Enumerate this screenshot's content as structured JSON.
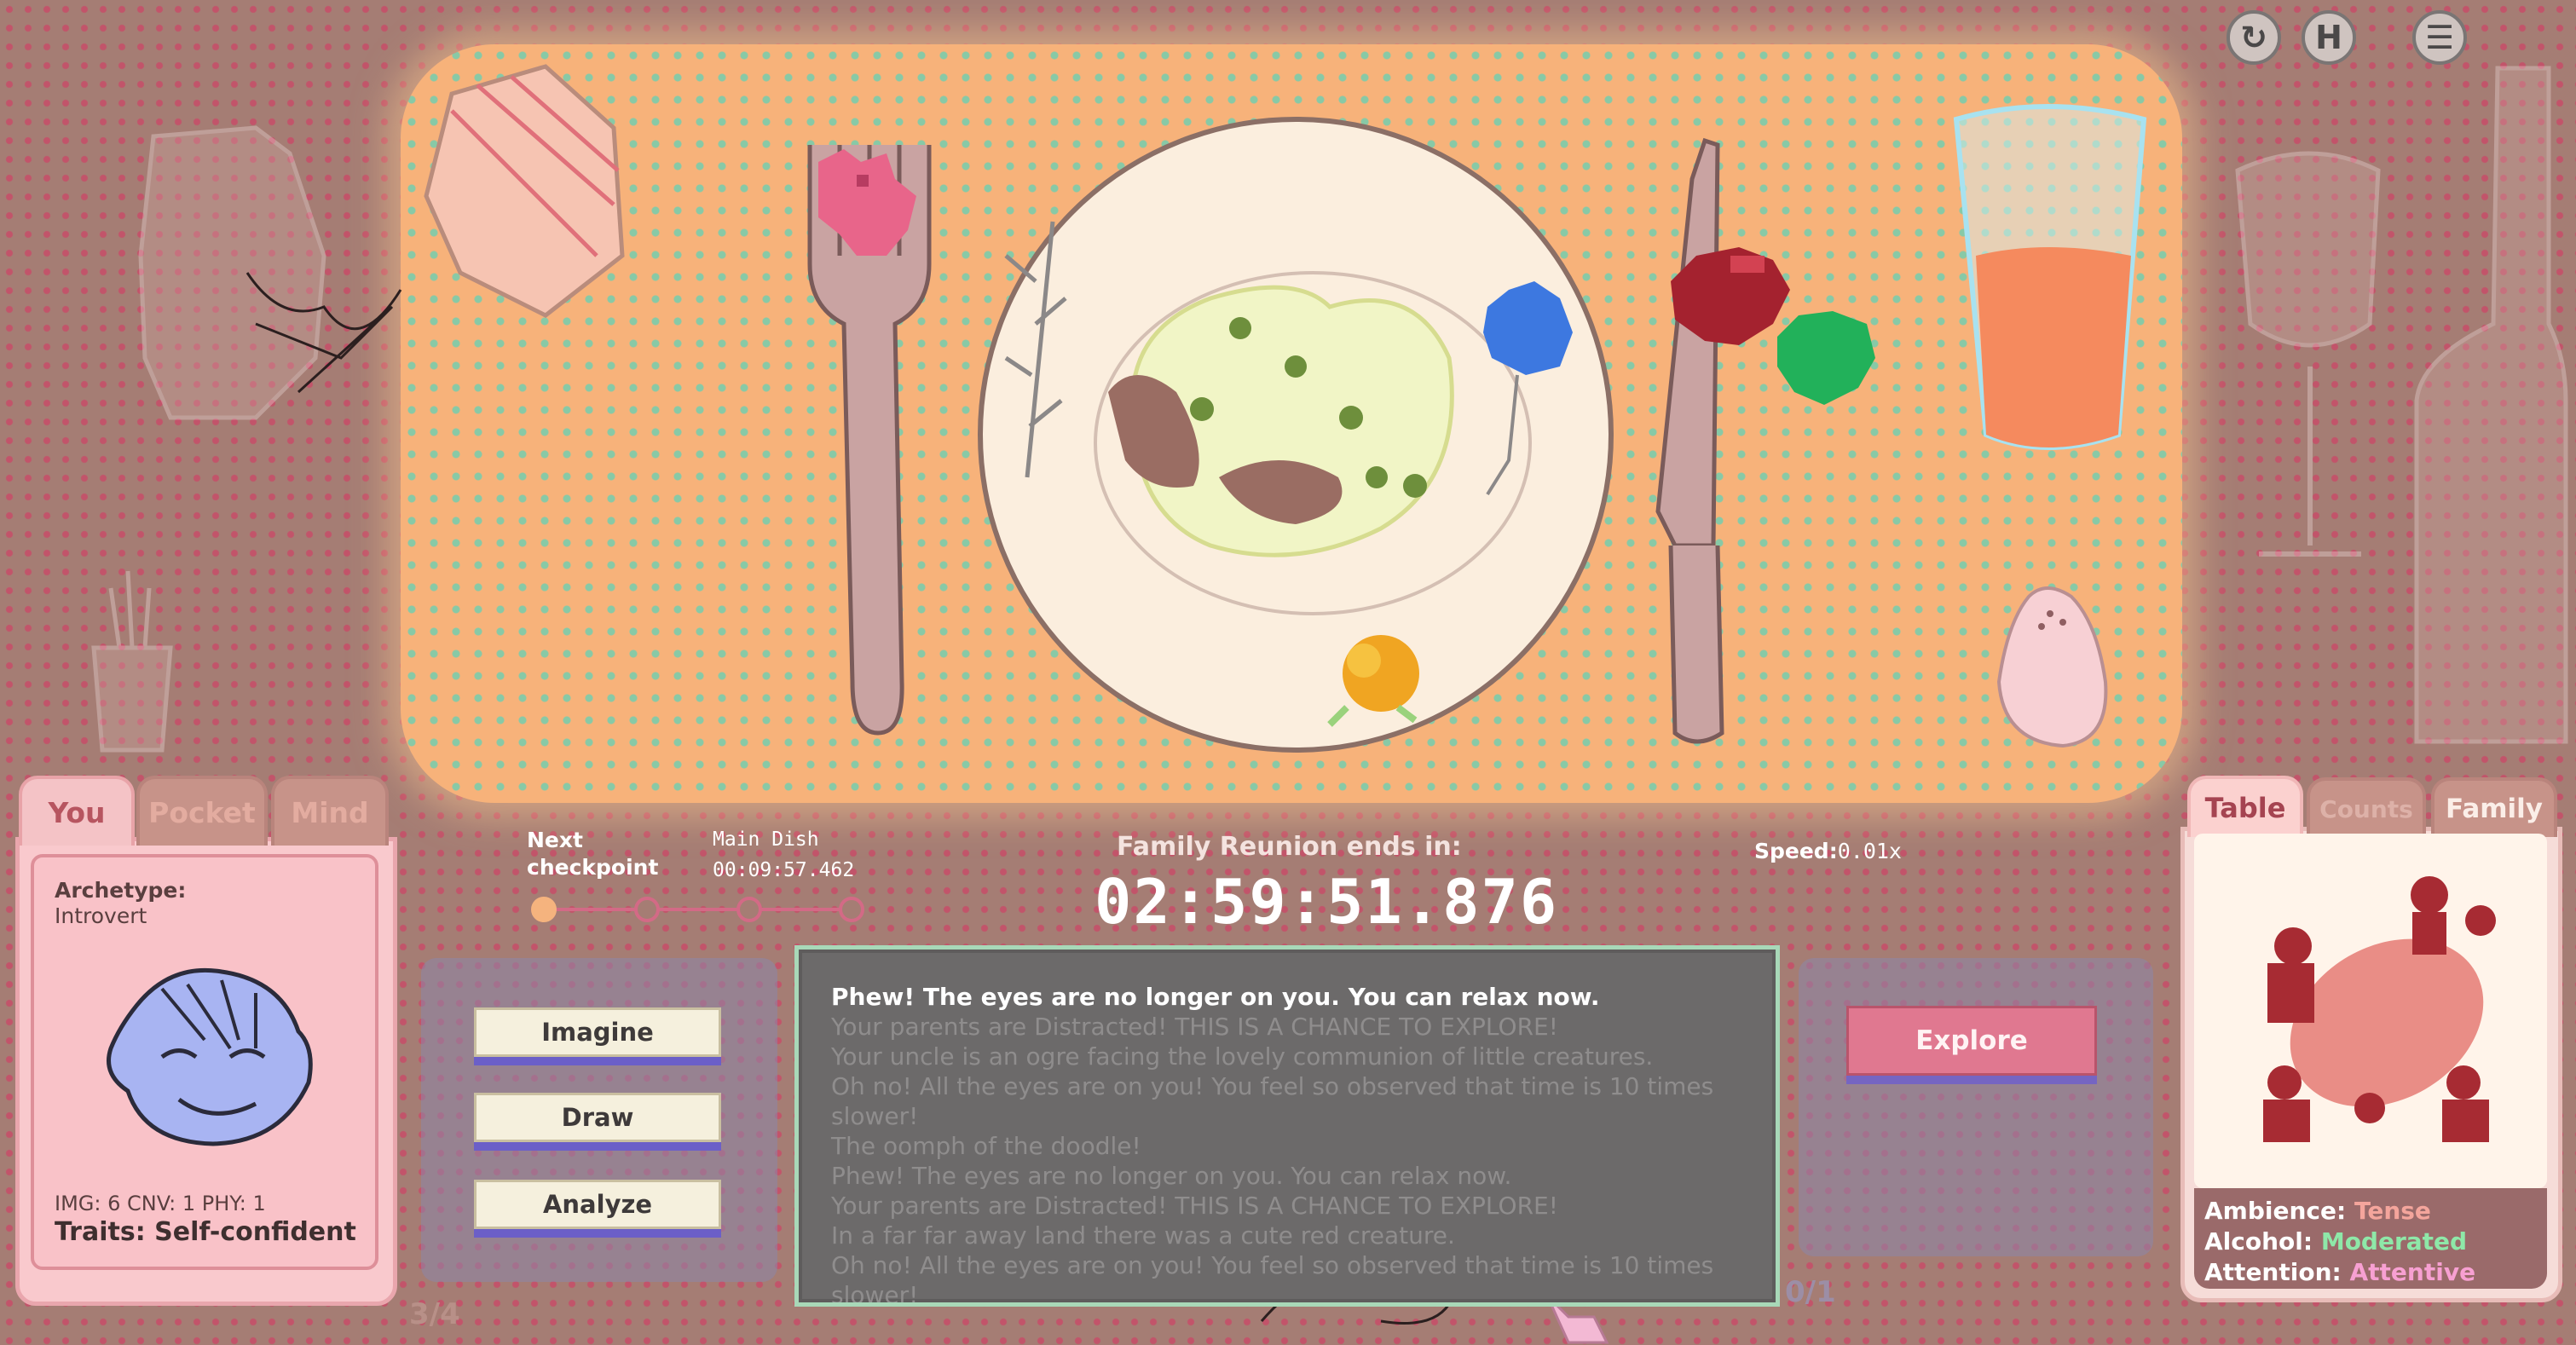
{
  "top_icons": [
    {
      "name": "restart-icon",
      "glyph": "↻"
    },
    {
      "name": "hint-icon",
      "glyph": "H"
    },
    {
      "name": "menu-icon",
      "glyph": "☰"
    }
  ],
  "left_tabs": [
    {
      "label": "You",
      "active": true
    },
    {
      "label": "Pocket",
      "active": false
    },
    {
      "label": "Mind",
      "active": false
    }
  ],
  "profile": {
    "archetype_label": "Archetype:",
    "archetype_value": "Introvert",
    "stats": "IMG:  6   CNV:  1   PHY:  1",
    "traits": "Traits: Self-confident"
  },
  "checkpoint": {
    "label": "Next checkpoint",
    "course": "Main Dish",
    "time": "00:09:57.462",
    "reached": 1,
    "total": 4
  },
  "timer": {
    "label": "Family Reunion ends in:",
    "value": "02:59:51.876"
  },
  "speed": {
    "label": "Speed:",
    "value": "0.01x"
  },
  "actions": [
    "Imagine",
    "Draw",
    "Analyze"
  ],
  "explore_label": "Explore",
  "left_counter": "3/4",
  "right_counter": "0/1",
  "log": {
    "first": "Phew! The eyes are no longer on you. You can relax now.",
    "lines": [
      "Your parents are Distracted! THIS IS A CHANCE TO EXPLORE!",
      "Your uncle is an ogre facing the lovely communion of little creatures.",
      "Oh no! All the eyes are on you! You feel so observed that time is 10 times slower!",
      "The oomph of the doodle!",
      "Phew! The eyes are no longer on you. You can relax now.",
      "Your parents are Distracted! THIS IS A CHANCE TO EXPLORE!",
      "In a far far away land there was a cute red creature.",
      "Oh no! All the eyes are on you! You feel so observed that time is 10 times slower!"
    ]
  },
  "right_tabs": [
    {
      "label": "Table",
      "active": true
    },
    {
      "label": "Counts",
      "active": false
    },
    {
      "label": "Family",
      "active": false
    }
  ],
  "status": {
    "ambience_label": "Ambience:",
    "ambience_value": "Tense",
    "ambience_color": "#f4a59c",
    "alcohol_label": "Alcohol:",
    "alcohol_value": "Moderated",
    "alcohol_color": "#8ee8a8",
    "attention_label": "Attention:",
    "attention_value": "Attentive",
    "attention_color": "#f7a0d2"
  },
  "colors": {
    "accent_pink": "#e07890",
    "tab_pink": "#f4c3c6",
    "button_shadow": "#6b5fc8"
  }
}
